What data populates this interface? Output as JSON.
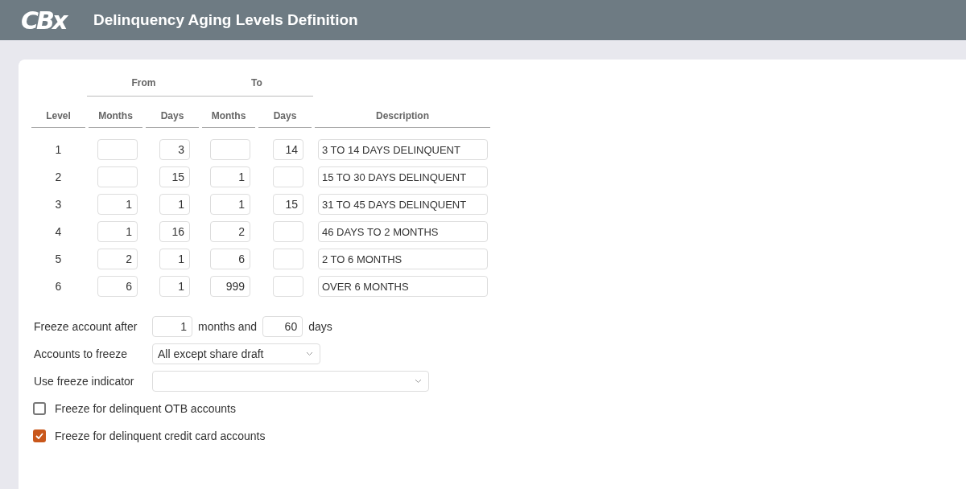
{
  "header": {
    "logo": "CBx",
    "title": "Delinquency Aging Levels Definition"
  },
  "table": {
    "groups": [
      "From",
      "To"
    ],
    "columns": [
      "Level",
      "Months",
      "Days",
      "Months",
      "Days",
      "Description"
    ],
    "rows": [
      {
        "level": "1",
        "from_months": "",
        "from_days": "3",
        "to_months": "",
        "to_days": "14",
        "description": "3 TO 14 DAYS DELINQUENT"
      },
      {
        "level": "2",
        "from_months": "",
        "from_days": "15",
        "to_months": "1",
        "to_days": "",
        "description": "15 TO 30 DAYS DELINQUENT"
      },
      {
        "level": "3",
        "from_months": "1",
        "from_days": "1",
        "to_months": "1",
        "to_days": "15",
        "description": "31 TO 45 DAYS DELINQUENT"
      },
      {
        "level": "4",
        "from_months": "1",
        "from_days": "16",
        "to_months": "2",
        "to_days": "",
        "description": "46 DAYS TO 2 MONTHS"
      },
      {
        "level": "5",
        "from_months": "2",
        "from_days": "1",
        "to_months": "6",
        "to_days": "",
        "description": "2 TO 6 MONTHS"
      },
      {
        "level": "6",
        "from_months": "6",
        "from_days": "1",
        "to_months": "999",
        "to_days": "",
        "description": "OVER 6 MONTHS"
      }
    ]
  },
  "freeze_after": {
    "label": "Freeze account after",
    "months": "1",
    "months_label": "months and",
    "days": "60",
    "days_label": "days"
  },
  "accounts_to_freeze": {
    "label": "Accounts to freeze",
    "value": "All except share draft"
  },
  "use_freeze_indicator": {
    "label": "Use freeze indicator"
  },
  "checkboxes": [
    {
      "label": "Freeze for delinquent OTB accounts",
      "checked": false
    },
    {
      "label": "Freeze for delinquent credit card accounts",
      "checked": true
    }
  ]
}
